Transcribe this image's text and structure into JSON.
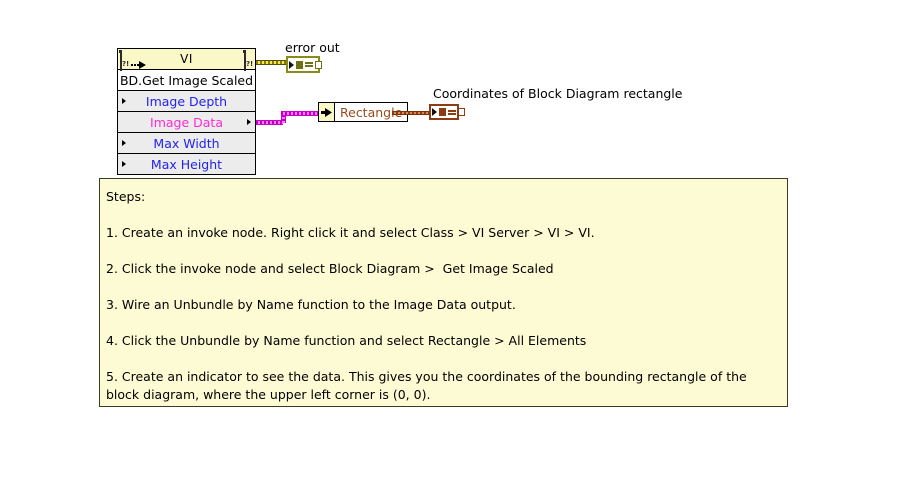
{
  "colors": {
    "node_header_bg": "#fbf8c8",
    "node_row_bg": "#ececec",
    "input_terminal_text": "#2222ee",
    "output_terminal_text": "#ff2ad4",
    "unbundle_name_text": "#9c4a1a",
    "error_wire": "#8a7a10",
    "image_data_wire": "#cc00cc",
    "cluster_wire": "#8d3b10",
    "steps_box_bg": "#fdfbd4",
    "steps_box_border": "#3b3b20",
    "canvas_bg": "#ffffff"
  },
  "invoke_node": {
    "header_title": "VI",
    "method": "BD.Get Image Scaled",
    "terminals": [
      {
        "label": "Image Depth",
        "direction": "input"
      },
      {
        "label": "Image Data",
        "direction": "output"
      },
      {
        "label": "Max Width",
        "direction": "input"
      },
      {
        "label": "Max Height",
        "direction": "input"
      }
    ]
  },
  "labels": {
    "error_out": "error out",
    "coordinates": "Coordinates of Block Diagram rectangle"
  },
  "unbundle_node": {
    "element": "Rectangle"
  },
  "steps": {
    "heading": "Steps:",
    "items": [
      "1. Create an invoke node. Right click it and select Class > VI Server > VI > VI.",
      "2. Click the invoke node and select Block Diagram >  Get Image Scaled",
      "3. Wire an Unbundle by Name function to the Image Data output.",
      "4. Click the Unbundle by Name function and select Rectangle > All Elements",
      "5. Create an indicator to see the data. This gives you the coordinates of the bounding rectangle of the block diagram, where the upper left corner is (0, 0)."
    ]
  }
}
